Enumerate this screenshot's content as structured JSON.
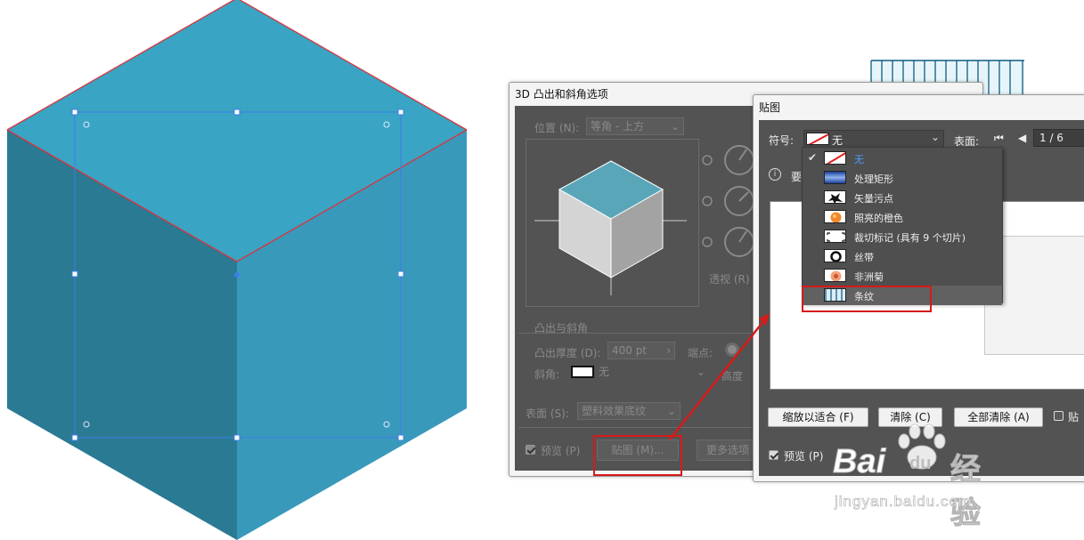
{
  "colors": {
    "cube_top": "#3aa4c4",
    "cube_left": "#2a7a93",
    "cube_right": "#3999bb",
    "edge": "#d8343c",
    "selection": "#3f7de6",
    "panel": "#535353",
    "annotation": "#d61a1a"
  },
  "dialog3d": {
    "title": "3D 凸出和斜角选项",
    "position_label": "位置 (N):",
    "position_value": "等角 - 上方",
    "perspective_label": "透视 (R)",
    "extrude_section": "凸出与斜角",
    "depth_label": "凸出厚度 (D):",
    "depth_value": "400 pt",
    "cap_label": "端点:",
    "bevel_label": "斜角:",
    "bevel_value": "无",
    "height_label": "高度",
    "surface_label": "表面 (S):",
    "surface_value": "塑料效果底纹",
    "preview_label": "预览 (P)",
    "map_button": "贴图 (M)...",
    "more_button": "更多选项"
  },
  "mapdlg": {
    "title": "贴图",
    "symbol_label": "符号:",
    "symbol_value": "无",
    "surface_label": "表面:",
    "surface_value": "1 / 6",
    "info_text": "要",
    "fit_button": "缩放以适合 (F)",
    "clear_button": "清除 (C)",
    "clear_all_button": "全部清除 (A)",
    "shade_label": "贴",
    "preview_label": "预览 (P)"
  },
  "symbol_menu": [
    {
      "label": "无",
      "swatch": "none",
      "checked": true
    },
    {
      "label": "处理矩形",
      "swatch": "gradient"
    },
    {
      "label": "矢量污点",
      "swatch": "splat"
    },
    {
      "label": "照亮的橙色",
      "swatch": "orange"
    },
    {
      "label": "裁切标记 (具有 9 个切片)",
      "swatch": "crop"
    },
    {
      "label": "丝带",
      "swatch": "ribbon"
    },
    {
      "label": "非洲菊",
      "swatch": "flower"
    },
    {
      "label": "条纹",
      "swatch": "stripes",
      "highlighted": true
    }
  ],
  "watermark": {
    "brand": "Bai",
    "brand_du": "du",
    "brand_cn": "经验",
    "url": "jingyan.baidu.com"
  }
}
